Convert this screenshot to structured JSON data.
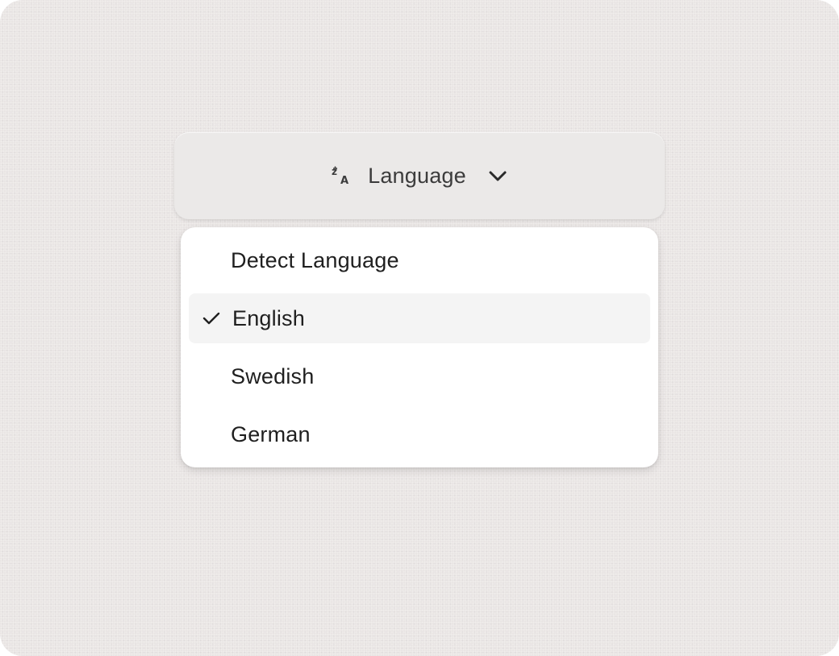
{
  "dropdown": {
    "trigger_label": "Language",
    "trigger_icon": "translate-icon",
    "chevron_icon": "chevron-down-icon",
    "options": [
      {
        "label": "Detect Language",
        "selected": false
      },
      {
        "label": "English",
        "selected": true
      },
      {
        "label": "Swedish",
        "selected": false
      },
      {
        "label": "German",
        "selected": false
      }
    ],
    "selected_value": "English"
  },
  "colors": {
    "background": "#e9e5e4",
    "trigger_bg": "#ebe9e8",
    "menu_bg": "#ffffff",
    "selected_bg": "#f4f4f4",
    "text": "#1f1f1f",
    "trigger_text": "#3c3c3c"
  }
}
